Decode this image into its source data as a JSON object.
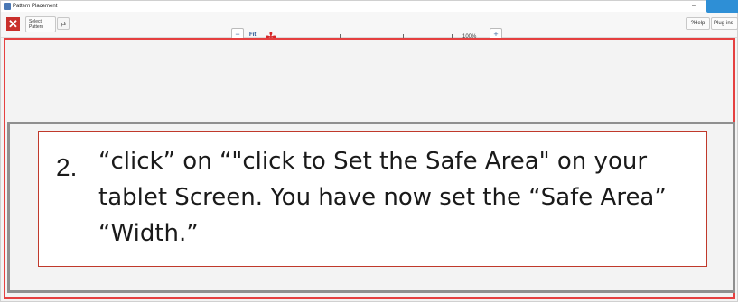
{
  "window": {
    "title": "Pattern Placement",
    "controls": [
      "–",
      "❐",
      "✕"
    ]
  },
  "toolbar": {
    "close_glyph": "✕",
    "select_pattern_label": "Select Pattern",
    "help_label": "?Help",
    "plugins_label": "Plug-ins"
  },
  "zoom": {
    "fit_label": "Fit",
    "zoom_level": "100%",
    "zoom_out_glyph": "−",
    "zoom_in_glyph": "+"
  },
  "instruction": {
    "number": "2.",
    "text": "“click” on “\"click to Set the Safe Area\" on your tablet Screen.  You have now set the “Safe Area” “Width.”"
  },
  "colors": {
    "canvas_border": "#e54040",
    "callout_border": "#c0392b",
    "accent_blue": "#2e8fd6"
  }
}
